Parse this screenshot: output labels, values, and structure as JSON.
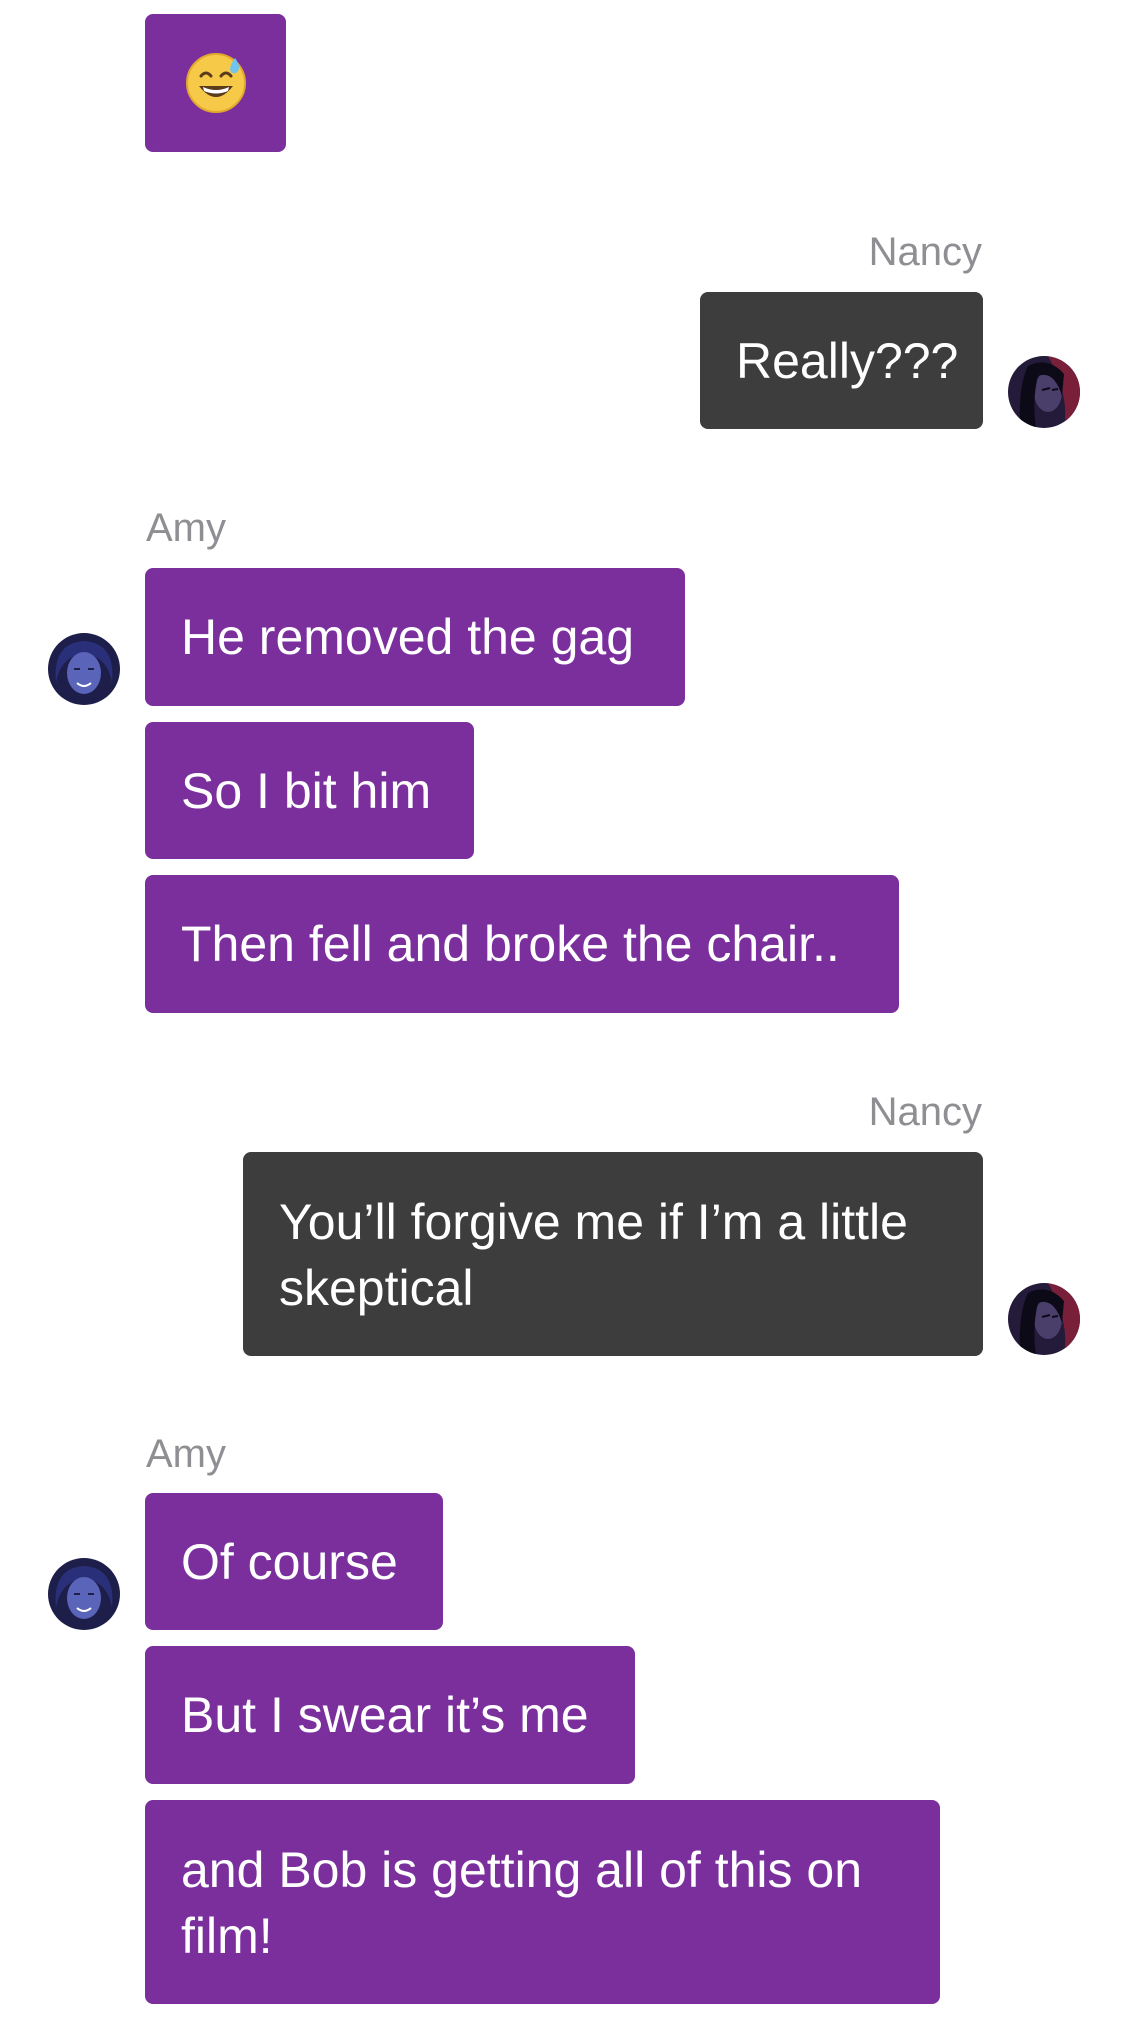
{
  "conversation": {
    "emoji_message": {
      "icon": "grinning-face-with-sweat-icon",
      "text": "😅"
    },
    "nancy_name_1": "Nancy",
    "nancy_msg_1": "Really???",
    "amy_name_1": "Amy",
    "amy_msgs_1": [
      "He removed the gag",
      "So I bit him",
      "Then fell and broke the chair.."
    ],
    "nancy_name_2": "Nancy",
    "nancy_msg_2": "You’ll forgive me if I’m a little skeptical",
    "amy_name_2": "Amy",
    "amy_msgs_2": [
      "Of course",
      "But I swear it’s me",
      "and Bob is getting all of this on film!"
    ]
  },
  "colors": {
    "amy_bubble": "#7b2f9d",
    "nancy_bubble": "#3d3d3d",
    "sender_name": "#8e8e93"
  }
}
